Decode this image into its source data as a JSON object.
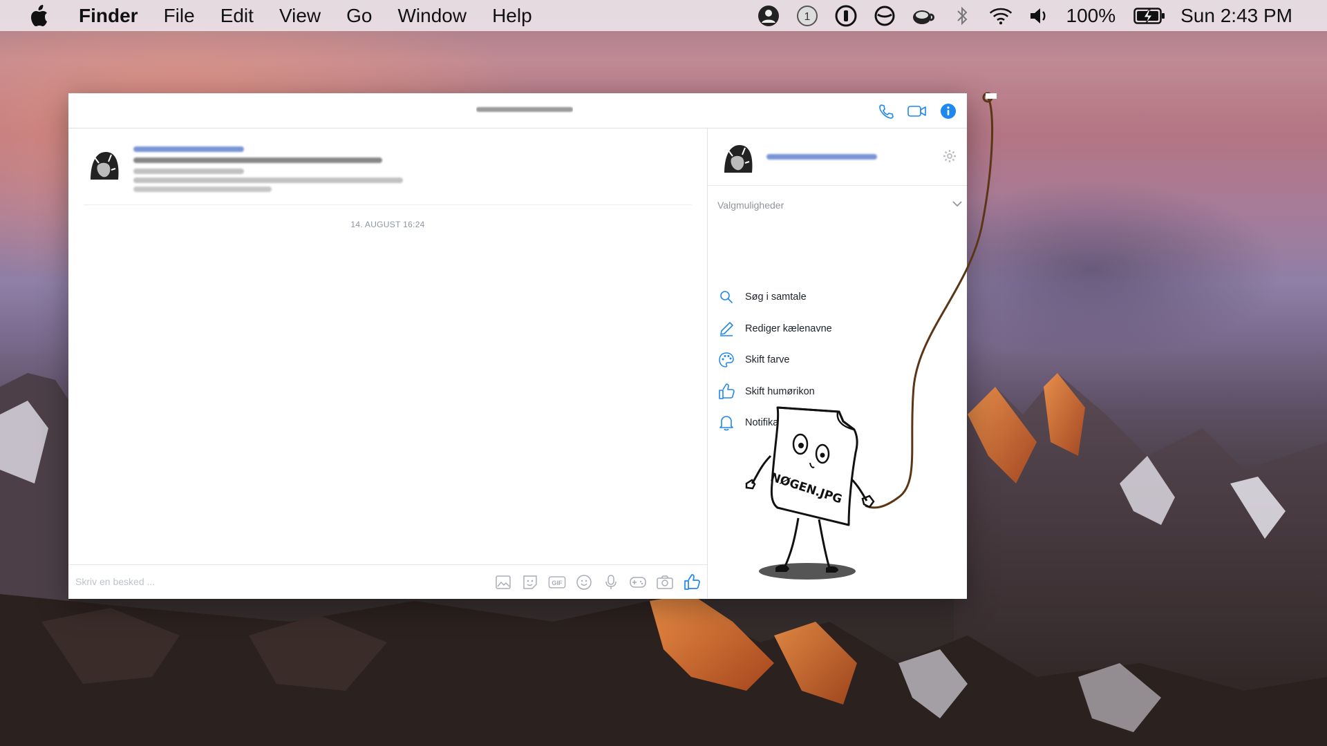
{
  "menubar": {
    "app_name": "Finder",
    "items": [
      "File",
      "Edit",
      "View",
      "Go",
      "Window",
      "Help"
    ],
    "status": {
      "notification_count": "1",
      "battery": "100%",
      "clock": "Sun 2:43 PM"
    },
    "status_icons": [
      "profile-icon",
      "badge-1-icon",
      "password-manager-icon",
      "sync-icon",
      "coffee-icon",
      "bluetooth-icon",
      "wifi-icon",
      "volume-icon",
      "battery-charging-icon"
    ]
  },
  "messenger": {
    "header_icons": [
      "phone-icon",
      "video-camera-icon",
      "info-icon"
    ],
    "accent_color": "#1e87f0",
    "timestamp": "14. AUGUST 16:24",
    "composer_placeholder": "Skriv en besked ...",
    "composer_icons": [
      "image-icon",
      "sticker-icon",
      "gif-icon",
      "emoji-icon",
      "microphone-icon",
      "game-icon",
      "camera-icon",
      "like-icon"
    ],
    "gif_label": "GIF",
    "options": {
      "title": "Valgmuligheder",
      "items": [
        {
          "label": "Søg i samtale",
          "icon": "search-icon"
        },
        {
          "label": "Rediger kælenavne",
          "icon": "pencil-icon"
        },
        {
          "label": "Skift farve",
          "icon": "palette-icon"
        },
        {
          "label": "Skift humørikon",
          "icon": "thumbs-up-icon"
        },
        {
          "label": "Notifikationer",
          "icon": "bell-icon"
        }
      ]
    }
  },
  "doodle": {
    "label": "NØGEN.JPG"
  }
}
